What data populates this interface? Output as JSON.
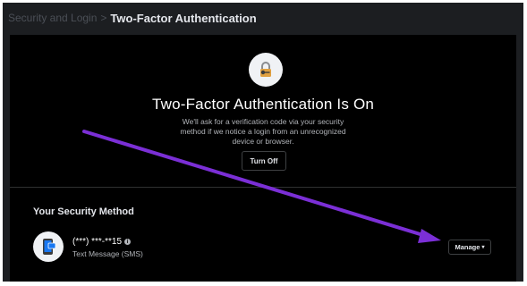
{
  "breadcrumb": {
    "parent": "Security and Login",
    "separator": ">",
    "current": "Two-Factor Authentication"
  },
  "status": {
    "title": "Two-Factor Authentication Is On",
    "description": "We'll ask for a verification code via your security method if we notice a login from an unrecognized device or browser.",
    "turn_off_label": "Turn Off"
  },
  "security_method": {
    "heading": "Your Security Method",
    "number": "(***) ***-**15",
    "info_glyph": "i",
    "type": "Text Message (SMS)",
    "manage_label": "Manage",
    "manage_caret": "▾"
  },
  "icons": {
    "status_icon": "lock-icon",
    "method_icon": "phone-icon",
    "overlay": "purple-arrow-annotation"
  },
  "colors": {
    "background": "#1c1e21",
    "card": "#000000",
    "text_primary": "#e4e6eb",
    "text_secondary": "#b0b3b8",
    "lock_accent": "#e0a040",
    "phone_accent": "#1877f2",
    "annotation_arrow": "#7b2fd6"
  }
}
